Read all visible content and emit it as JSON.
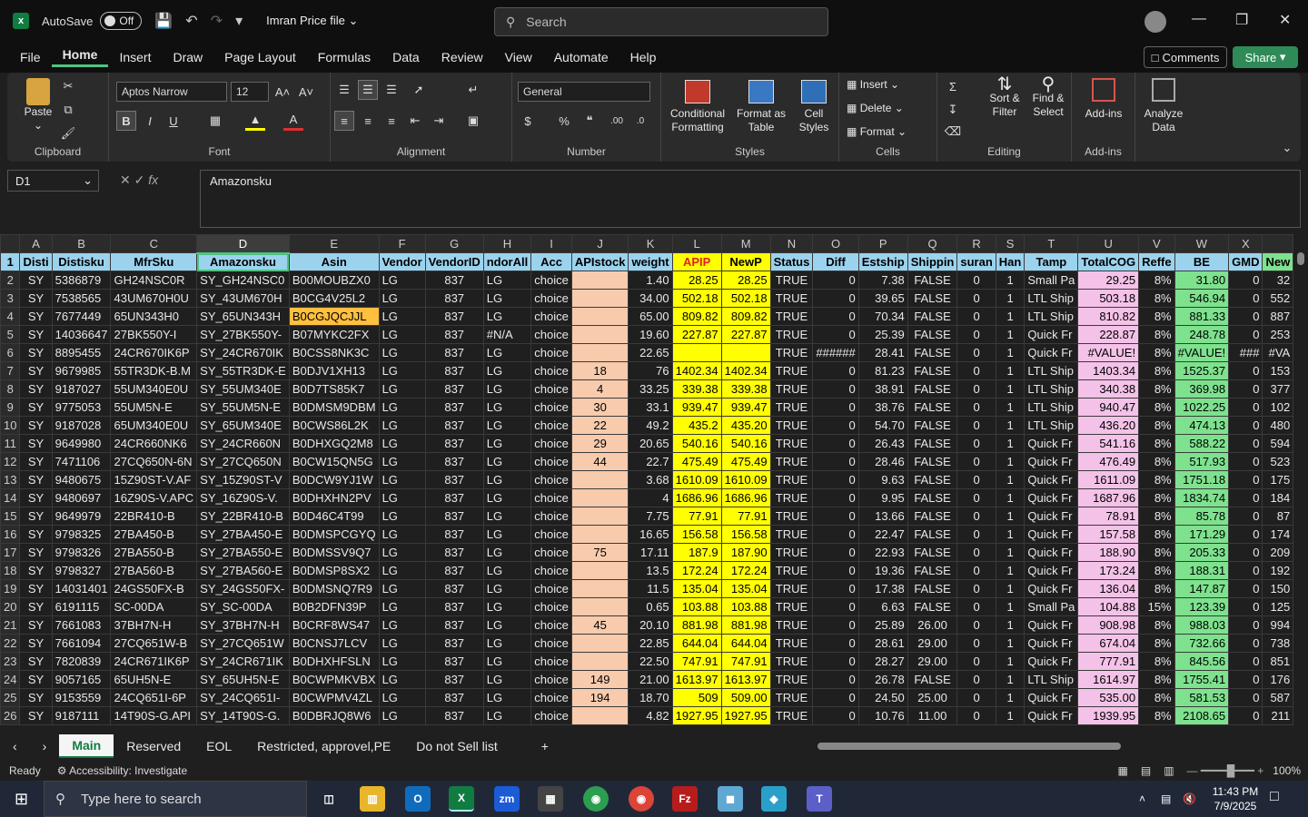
{
  "titlebar": {
    "autosave_label": "AutoSave",
    "autosave_state": "Off",
    "filename": "Imran Price file",
    "search_placeholder": "Search"
  },
  "menu": [
    "File",
    "Home",
    "Insert",
    "Draw",
    "Page Layout",
    "Formulas",
    "Data",
    "Review",
    "View",
    "Automate",
    "Help"
  ],
  "menu_active": "Home",
  "comments_label": "Comments",
  "share_label": "Share",
  "ribbon": {
    "paste": "Paste",
    "clipboard": "Clipboard",
    "font_name": "Aptos Narrow",
    "font_size": "12",
    "font": "Font",
    "alignment": "Alignment",
    "number_format": "General",
    "number": "Number",
    "cond_format": "Conditional Formatting",
    "format_table": "Format as Table",
    "cell_styles": "Cell Styles",
    "styles": "Styles",
    "insert": "Insert",
    "delete": "Delete",
    "format": "Format",
    "cells": "Cells",
    "sort_filter": "Sort & Filter",
    "find_select": "Find & Select",
    "editing": "Editing",
    "addins": "Add-ins",
    "addins_group": "Add-ins",
    "analyze": "Analyze Data"
  },
  "formula": {
    "namebox": "D1",
    "content": "Amazonsku"
  },
  "columns": [
    "A",
    "B",
    "C",
    "D",
    "E",
    "F",
    "G",
    "H",
    "I",
    "J",
    "K",
    "L",
    "M",
    "N",
    "O",
    "P",
    "Q",
    "R",
    "S",
    "T",
    "U",
    "V",
    "W",
    "X",
    ""
  ],
  "headers": [
    "Disti",
    "Distisku",
    "MfrSku",
    "Amazonsku",
    "Asin",
    "Vendor",
    "VendorID",
    "ndorAll",
    "Acc",
    "APIstock",
    "weight",
    "APIP",
    "NewP",
    "Status",
    "Diff",
    "Estship",
    "Shippin",
    "suran",
    "Han",
    "Tamp",
    "TotalCOG",
    "Reffe",
    "BE",
    "GMD",
    "New"
  ],
  "rows": [
    [
      "2",
      "SY",
      "5386879",
      "GH24NSC0R",
      "SY_GH24NSC0",
      "B00MOUBZX0",
      "LG",
      "837",
      "LG",
      "choice",
      "",
      "1.40",
      "28.25",
      "28.25",
      "TRUE",
      "0",
      "7.38",
      "FALSE",
      "0",
      "1",
      "Small Pa",
      "29.25",
      "8%",
      "31.80",
      "0",
      "32"
    ],
    [
      "3",
      "SY",
      "7538565",
      "43UM670H0U",
      "SY_43UM670H",
      "B0CG4V25L2",
      "LG",
      "837",
      "LG",
      "choice",
      "",
      "34.00",
      "502.18",
      "502.18",
      "TRUE",
      "0",
      "39.65",
      "FALSE",
      "0",
      "1",
      "LTL Ship",
      "503.18",
      "8%",
      "546.94",
      "0",
      "552"
    ],
    [
      "4",
      "SY",
      "7677449",
      "65UN343H0",
      "SY_65UN343H",
      "B0CGJQCJJL",
      "LG",
      "837",
      "LG",
      "choice",
      "",
      "65.00",
      "809.82",
      "809.82",
      "TRUE",
      "0",
      "70.34",
      "FALSE",
      "0",
      "1",
      "LTL Ship",
      "810.82",
      "8%",
      "881.33",
      "0",
      "887"
    ],
    [
      "5",
      "SY",
      "14036647",
      "27BK550Y-I",
      "SY_27BK550Y-",
      "B07MYKC2FX",
      "LG",
      "837",
      "#N/A",
      "choice",
      "",
      "19.60",
      "227.87",
      "227.87",
      "TRUE",
      "0",
      "25.39",
      "FALSE",
      "0",
      "1",
      "Quick Fr",
      "228.87",
      "8%",
      "248.78",
      "0",
      "253"
    ],
    [
      "6",
      "SY",
      "8895455",
      "24CR670IK6P",
      "SY_24CR670IK",
      "B0CSS8NK3C",
      "LG",
      "837",
      "LG",
      "choice",
      "",
      "22.65",
      "",
      "",
      "TRUE",
      "######",
      "28.41",
      "FALSE",
      "0",
      "1",
      "Quick Fr",
      "#VALUE!",
      "8%",
      "#VALUE!",
      "###",
      "#VA"
    ],
    [
      "7",
      "SY",
      "9679985",
      "55TR3DK-B.M",
      "SY_55TR3DK-E",
      "B0DJV1XH13",
      "LG",
      "837",
      "LG",
      "choice",
      "18",
      "76",
      "1402.34",
      "1402.34",
      "TRUE",
      "0",
      "81.23",
      "FALSE",
      "0",
      "1",
      "LTL Ship",
      "1403.34",
      "8%",
      "1525.37",
      "0",
      "153"
    ],
    [
      "8",
      "SY",
      "9187027",
      "55UM340E0U",
      "SY_55UM340E",
      "B0D7TS85K7",
      "LG",
      "837",
      "LG",
      "choice",
      "4",
      "33.25",
      "339.38",
      "339.38",
      "TRUE",
      "0",
      "38.91",
      "FALSE",
      "0",
      "1",
      "LTL Ship",
      "340.38",
      "8%",
      "369.98",
      "0",
      "377"
    ],
    [
      "9",
      "SY",
      "9775053",
      "55UM5N-E",
      "SY_55UM5N-E",
      "B0DMSM9DBM",
      "LG",
      "837",
      "LG",
      "choice",
      "30",
      "33.1",
      "939.47",
      "939.47",
      "TRUE",
      "0",
      "38.76",
      "FALSE",
      "0",
      "1",
      "LTL Ship",
      "940.47",
      "8%",
      "1022.25",
      "0",
      "102"
    ],
    [
      "10",
      "SY",
      "9187028",
      "65UM340E0U",
      "SY_65UM340E",
      "B0CWS86L2K",
      "LG",
      "837",
      "LG",
      "choice",
      "22",
      "49.2",
      "435.2",
      "435.20",
      "TRUE",
      "0",
      "54.70",
      "FALSE",
      "0",
      "1",
      "LTL Ship",
      "436.20",
      "8%",
      "474.13",
      "0",
      "480"
    ],
    [
      "11",
      "SY",
      "9649980",
      "24CR660NK6",
      "SY_24CR660N",
      "B0DHXGQ2M8",
      "LG",
      "837",
      "LG",
      "choice",
      "29",
      "20.65",
      "540.16",
      "540.16",
      "TRUE",
      "0",
      "26.43",
      "FALSE",
      "0",
      "1",
      "Quick Fr",
      "541.16",
      "8%",
      "588.22",
      "0",
      "594"
    ],
    [
      "12",
      "SY",
      "7471106",
      "27CQ650N-6N",
      "SY_27CQ650N",
      "B0CW15QN5G",
      "LG",
      "837",
      "LG",
      "choice",
      "44",
      "22.7",
      "475.49",
      "475.49",
      "TRUE",
      "0",
      "28.46",
      "FALSE",
      "0",
      "1",
      "Quick Fr",
      "476.49",
      "8%",
      "517.93",
      "0",
      "523"
    ],
    [
      "13",
      "SY",
      "9480675",
      "15Z90ST-V.AF",
      "SY_15Z90ST-V",
      "B0DCW9YJ1W",
      "LG",
      "837",
      "LG",
      "choice",
      "",
      "3.68",
      "1610.09",
      "1610.09",
      "TRUE",
      "0",
      "9.63",
      "FALSE",
      "0",
      "1",
      "Quick Fr",
      "1611.09",
      "8%",
      "1751.18",
      "0",
      "175"
    ],
    [
      "14",
      "SY",
      "9480697",
      "16Z90S-V.APC",
      "SY_16Z90S-V.",
      "B0DHXHN2PV",
      "LG",
      "837",
      "LG",
      "choice",
      "",
      "4",
      "1686.96",
      "1686.96",
      "TRUE",
      "0",
      "9.95",
      "FALSE",
      "0",
      "1",
      "Quick Fr",
      "1687.96",
      "8%",
      "1834.74",
      "0",
      "184"
    ],
    [
      "15",
      "SY",
      "9649979",
      "22BR410-B",
      "SY_22BR410-B",
      "B0D46C4T99",
      "LG",
      "837",
      "LG",
      "choice",
      "",
      "7.75",
      "77.91",
      "77.91",
      "TRUE",
      "0",
      "13.66",
      "FALSE",
      "0",
      "1",
      "Quick Fr",
      "78.91",
      "8%",
      "85.78",
      "0",
      "87"
    ],
    [
      "16",
      "SY",
      "9798325",
      "27BA450-B",
      "SY_27BA450-E",
      "B0DMSPCGYQ",
      "LG",
      "837",
      "LG",
      "choice",
      "",
      "16.65",
      "156.58",
      "156.58",
      "TRUE",
      "0",
      "22.47",
      "FALSE",
      "0",
      "1",
      "Quick Fr",
      "157.58",
      "8%",
      "171.29",
      "0",
      "174"
    ],
    [
      "17",
      "SY",
      "9798326",
      "27BA550-B",
      "SY_27BA550-E",
      "B0DMSSV9Q7",
      "LG",
      "837",
      "LG",
      "choice",
      "75",
      "17.11",
      "187.9",
      "187.90",
      "TRUE",
      "0",
      "22.93",
      "FALSE",
      "0",
      "1",
      "Quick Fr",
      "188.90",
      "8%",
      "205.33",
      "0",
      "209"
    ],
    [
      "18",
      "SY",
      "9798327",
      "27BA560-B",
      "SY_27BA560-E",
      "B0DMSP8SX2",
      "LG",
      "837",
      "LG",
      "choice",
      "",
      "13.5",
      "172.24",
      "172.24",
      "TRUE",
      "0",
      "19.36",
      "FALSE",
      "0",
      "1",
      "Quick Fr",
      "173.24",
      "8%",
      "188.31",
      "0",
      "192"
    ],
    [
      "19",
      "SY",
      "14031401",
      "24GS50FX-B",
      "SY_24GS50FX-",
      "B0DMSNQ7R9",
      "LG",
      "837",
      "LG",
      "choice",
      "",
      "11.5",
      "135.04",
      "135.04",
      "TRUE",
      "0",
      "17.38",
      "FALSE",
      "0",
      "1",
      "Quick Fr",
      "136.04",
      "8%",
      "147.87",
      "0",
      "150"
    ],
    [
      "20",
      "SY",
      "6191115",
      "SC-00DA",
      "SY_SC-00DA",
      "B0B2DFN39P",
      "LG",
      "837",
      "LG",
      "choice",
      "",
      "0.65",
      "103.88",
      "103.88",
      "TRUE",
      "0",
      "6.63",
      "FALSE",
      "0",
      "1",
      "Small Pa",
      "104.88",
      "15%",
      "123.39",
      "0",
      "125"
    ],
    [
      "21",
      "SY",
      "7661083",
      "37BH7N-H",
      "SY_37BH7N-H",
      "B0CRF8WS47",
      "LG",
      "837",
      "LG",
      "choice",
      "45",
      "20.10",
      "881.98",
      "881.98",
      "TRUE",
      "0",
      "25.89",
      "26.00",
      "0",
      "1",
      "Quick Fr",
      "908.98",
      "8%",
      "988.03",
      "0",
      "994"
    ],
    [
      "22",
      "SY",
      "7661094",
      "27CQ651W-B",
      "SY_27CQ651W",
      "B0CNSJ7LCV",
      "LG",
      "837",
      "LG",
      "choice",
      "",
      "22.85",
      "644.04",
      "644.04",
      "TRUE",
      "0",
      "28.61",
      "29.00",
      "0",
      "1",
      "Quick Fr",
      "674.04",
      "8%",
      "732.66",
      "0",
      "738"
    ],
    [
      "23",
      "SY",
      "7820839",
      "24CR671IK6P",
      "SY_24CR671IK",
      "B0DHXHFSLN",
      "LG",
      "837",
      "LG",
      "choice",
      "",
      "22.50",
      "747.91",
      "747.91",
      "TRUE",
      "0",
      "28.27",
      "29.00",
      "0",
      "1",
      "Quick Fr",
      "777.91",
      "8%",
      "845.56",
      "0",
      "851"
    ],
    [
      "24",
      "SY",
      "9057165",
      "65UH5N-E",
      "SY_65UH5N-E",
      "B0CWPMKVBX",
      "LG",
      "837",
      "LG",
      "choice",
      "149",
      "21.00",
      "1613.97",
      "1613.97",
      "TRUE",
      "0",
      "26.78",
      "FALSE",
      "0",
      "1",
      "LTL Ship",
      "1614.97",
      "8%",
      "1755.41",
      "0",
      "176"
    ],
    [
      "25",
      "SY",
      "9153559",
      "24CQ651I-6P",
      "SY_24CQ651I-",
      "B0CWPMV4ZL",
      "LG",
      "837",
      "LG",
      "choice",
      "194",
      "18.70",
      "509",
      "509.00",
      "TRUE",
      "0",
      "24.50",
      "25.00",
      "0",
      "1",
      "Quick Fr",
      "535.00",
      "8%",
      "581.53",
      "0",
      "587"
    ],
    [
      "26",
      "SY",
      "9187111",
      "14T90S-G.API",
      "SY_14T90S-G.",
      "B0DBRJQ8W6",
      "LG",
      "837",
      "LG",
      "choice",
      "",
      "4.82",
      "1927.95",
      "1927.95",
      "TRUE",
      "0",
      "10.76",
      "11.00",
      "0",
      "1",
      "Quick Fr",
      "1939.95",
      "8%",
      "2108.65",
      "0",
      "211"
    ]
  ],
  "sheets": [
    "Main",
    "Reserved",
    "EOL",
    "Restricted, approvel,PE",
    "Do not Sell list"
  ],
  "active_sheet": "Main",
  "status": {
    "ready": "Ready",
    "accessibility": "Accessibility: Investigate",
    "zoom": "100%"
  },
  "taskbar": {
    "search_placeholder": "Type here to search",
    "time": "11:43 PM",
    "date": "7/9/2025"
  },
  "colors": {
    "header_fill": "#9bd3ee",
    "peach": "#f8cbad",
    "yellow": "#ffff00",
    "pink": "#f4c2e8",
    "green": "#7ee18e",
    "excel_green": "#107c41"
  }
}
